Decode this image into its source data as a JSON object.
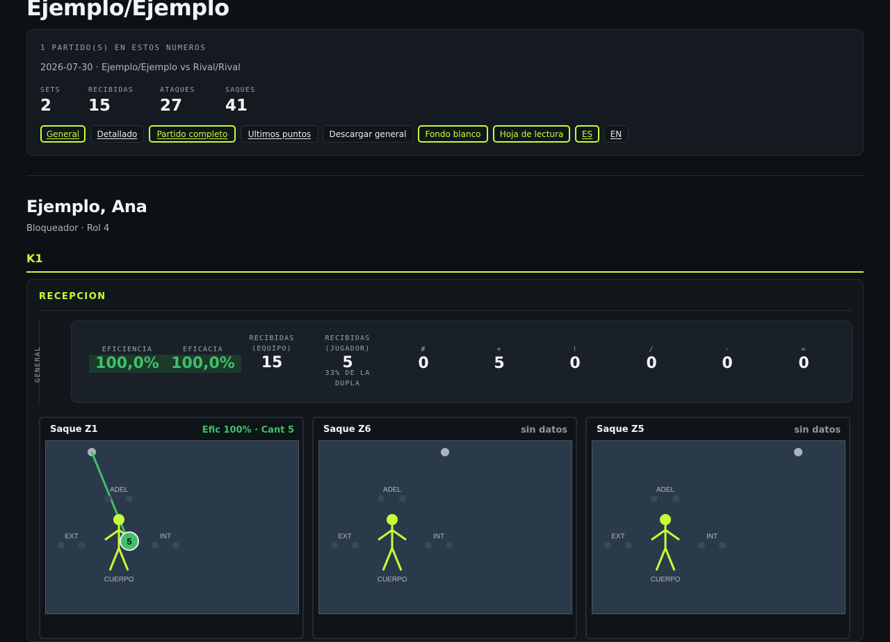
{
  "header": {
    "title": "Ejemplo/Ejemplo",
    "kicker": "1 PARTIDO(S) EN ESTOS NUMEROS",
    "match": "2026-07-30 · Ejemplo/Ejemplo vs Rival/Rival",
    "stats": [
      {
        "label": "SETS",
        "value": "2"
      },
      {
        "label": "RECIBIDAS",
        "value": "15"
      },
      {
        "label": "ATAQUES",
        "value": "27"
      },
      {
        "label": "SAQUES",
        "value": "41"
      }
    ],
    "buttons": [
      {
        "label": "General",
        "active": true
      },
      {
        "label": "Detallado",
        "active": false
      },
      {
        "label": "Partido completo",
        "active": true
      },
      {
        "label": "Ultimos puntos",
        "active": false
      },
      {
        "label": "Descargar general",
        "active": false
      },
      {
        "label": "Fondo blanco",
        "active": true
      },
      {
        "label": "Hoja de lectura",
        "active": true
      },
      {
        "label": "ES",
        "active": true
      },
      {
        "label": "EN",
        "active": false
      }
    ]
  },
  "player": {
    "name": "Ejemplo, Ana",
    "role": "Bloqueador · Rol 4",
    "phase": "K1"
  },
  "section": {
    "title": "RECEPCION",
    "group_label": "GENERAL",
    "metrics": [
      {
        "label": "EFICIENCIA",
        "value": "100,0%",
        "highlight": true
      },
      {
        "label": "EFICACIA",
        "value": "100,0%",
        "highlight": true
      },
      {
        "label": "RECIBIDAS\n(EQUIPO)",
        "value": "15"
      },
      {
        "label": "RECIBIDAS\n(JUGADOR)",
        "value": "5",
        "note": "33% DE LA\nDUPLA"
      },
      {
        "label": "#",
        "value": "0"
      },
      {
        "label": "+",
        "value": "5"
      },
      {
        "label": "!",
        "value": "0"
      },
      {
        "label": "/",
        "value": "0"
      },
      {
        "label": "-",
        "value": "0"
      },
      {
        "label": "=",
        "value": "0"
      }
    ],
    "courts": [
      {
        "title": "Saque Z1",
        "right": "Efic 100% · Cant 5",
        "good": true,
        "count": "5"
      },
      {
        "title": "Saque Z6",
        "right": "sin datos",
        "good": false
      },
      {
        "title": "Saque Z5",
        "right": "sin datos",
        "good": false
      }
    ],
    "zone_labels": {
      "adel": "ADEL",
      "ext": "EXT",
      "int": "INT",
      "cuerpo": "CUERPO"
    }
  },
  "colors": {
    "accent": "#c6ff3a",
    "good": "#3fbf6a",
    "bg": "#0d1014"
  }
}
